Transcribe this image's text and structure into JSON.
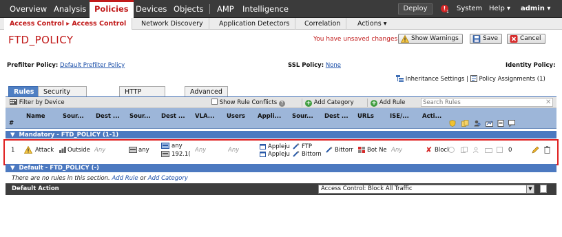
{
  "topnav": {
    "items": [
      "Overview",
      "Analysis",
      "Policies",
      "Devices",
      "Objects",
      "AMP",
      "Intelligence"
    ],
    "deploy_label": "Deploy",
    "alert_count": "1",
    "system_label": "System",
    "help_label": "Help ▾",
    "user_label": "admin ▾"
  },
  "subnav": {
    "items": [
      "Access Control ▸ Access Control",
      "Network Discovery",
      "Application Detectors",
      "Correlation",
      "Actions ▾"
    ]
  },
  "page": {
    "title": "FTD_POLICY",
    "unsaved_text": "You have unsaved changes",
    "show_warnings_label": "Show Warnings",
    "save_label": "Save",
    "cancel_label": "Cancel"
  },
  "filters": {
    "prefilter_label": "Prefilter Policy:",
    "prefilter_value": "Default Prefilter Policy",
    "ssl_label": "SSL Policy:",
    "ssl_value": "None",
    "identity_label": "Identity Policy:",
    "inheritance_label": "Inheritance Settings",
    "divider": "|",
    "assignments_label": "Policy Assignments (1)"
  },
  "tabs": [
    "Rules",
    "Security Intelligence",
    "HTTP Responses",
    "Advanced"
  ],
  "toolbar": {
    "filter_label": "Filter by Device",
    "show_conflicts_label": "Show Rule Conflicts",
    "add_category_label": "Add Category",
    "add_rule_label": "Add Rule",
    "search_placeholder": "Search Rules"
  },
  "table": {
    "hash": "#",
    "headers": [
      "Name",
      "Sour...",
      "Dest ...",
      "Sour...",
      "Dest ...",
      "VLA...",
      "Users",
      "Appli...",
      "Sour...",
      "Dest ...",
      "URLs",
      "ISE/...",
      "Acti..."
    ]
  },
  "sections": {
    "mandatory": "Mandatory - FTD_POLICY (1-1)",
    "default": "Default - FTD_POLICY (-)"
  },
  "rule": {
    "number": "1",
    "name": "Attack",
    "source_zone": "Outside",
    "dest_zone": "Any",
    "source_network": "any",
    "dest_network_1": "any",
    "dest_network_2": "192.1(",
    "vlan": "Any",
    "users": "Any",
    "application_1": "Appleju",
    "application_2": "Appleju",
    "source_port": "FTP",
    "source_port_2": "Bittorn",
    "dest_port": "Bittorr",
    "urls": "Bot Ne",
    "ise": "Any",
    "action": "Block",
    "hit_count": "0"
  },
  "default_section": {
    "no_rules_prefix": "There are no rules in this section.",
    "add_rule_link": "Add Rule",
    "or_text": "or",
    "add_category_link": "Add Category"
  },
  "default_action": {
    "label": "Default Action",
    "value": "Access Control: Block All Traffic"
  }
}
